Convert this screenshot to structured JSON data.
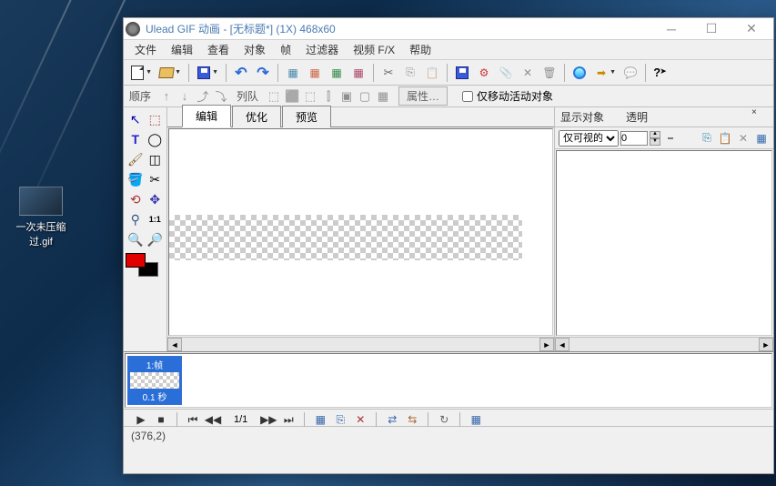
{
  "desktop": {
    "file_label": "一次未压缩过.gif"
  },
  "titlebar": {
    "title": "Ulead GIF 动画 - [无标题*] (1X) 468x60"
  },
  "menubar": {
    "items": [
      "文件",
      "编辑",
      "查看",
      "对象",
      "帧",
      "过滤器",
      "视频 F/X",
      "帮助"
    ]
  },
  "seqbar": {
    "order_label": "顺序",
    "queue_label": "列队",
    "prop_btn": "属性…",
    "move_only_label": "仅移动活动对象"
  },
  "view_tabs": {
    "items": [
      "编辑",
      "优化",
      "预览"
    ],
    "active": 0
  },
  "right_panel": {
    "header1": "显示对象",
    "header2": "透明",
    "visibility_select": "仅可视的",
    "opacity_value": "0"
  },
  "timeline": {
    "frame_label": "1:帧",
    "frame_time": "0.1 秒",
    "counter": "1/1"
  },
  "statusbar": {
    "coords": "(376,2)"
  },
  "tool_palette_zoom": "1:1"
}
